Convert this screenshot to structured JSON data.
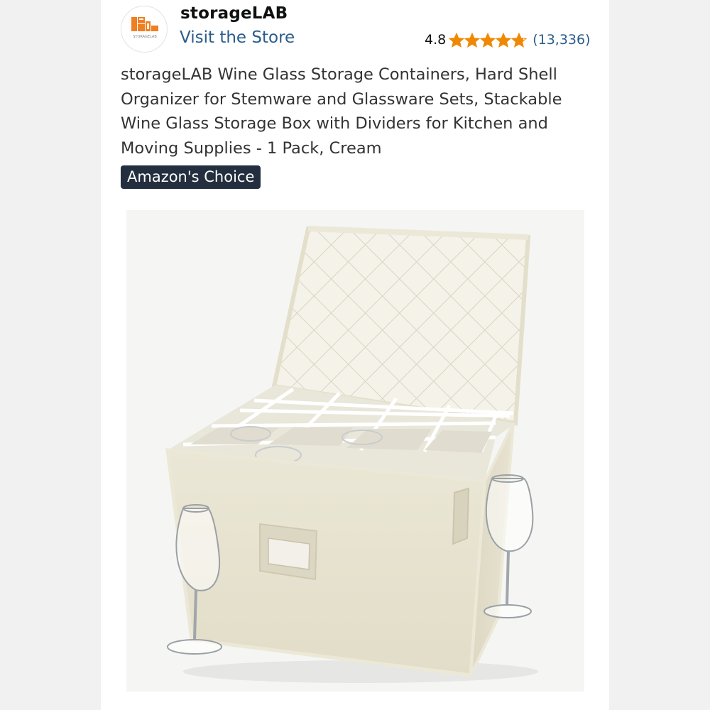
{
  "store": {
    "brand_name": "storageLAB",
    "logo_text": "STORAGELAB",
    "visit_store_label": "Visit the Store"
  },
  "rating": {
    "value": "4.8",
    "stars": 4.8,
    "stars_max": 5,
    "review_count": "(13,336)"
  },
  "product": {
    "title": "storageLAB Wine Glass Storage Containers, Hard Shell Organizer for Stemware and Glassware Sets, Stackable Wine Glass Storage Box with Dividers for Kitchen and Moving Supplies - 1 Pack, Cream",
    "badge": "Amazon's Choice"
  },
  "colors": {
    "link": "#2a5c8a",
    "star": "#f08804",
    "badge_bg": "#232f3e",
    "logo_orange": "#f07f22"
  }
}
